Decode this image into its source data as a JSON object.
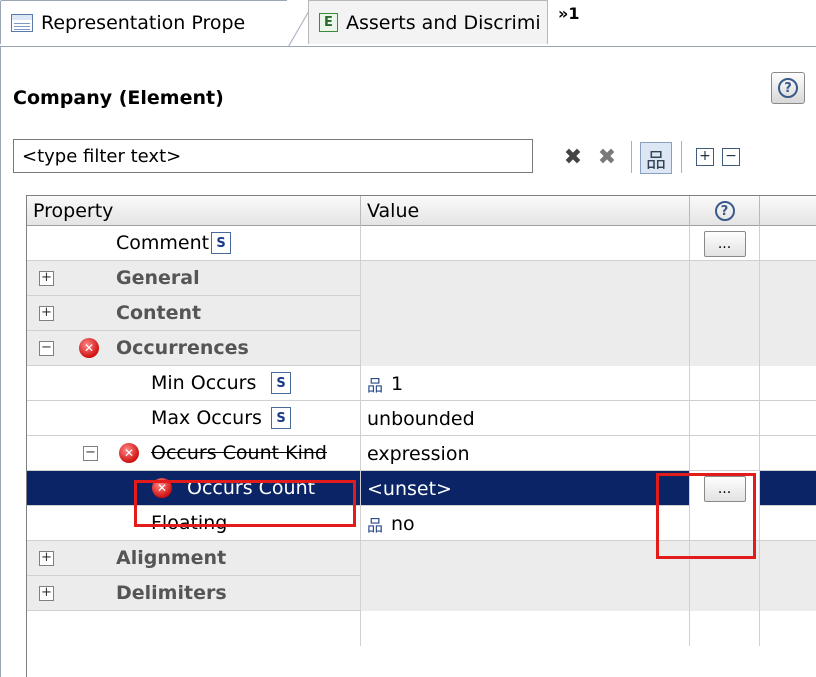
{
  "tabs": [
    {
      "label": "Representation Prope",
      "icon": "doc-icon",
      "active": true
    },
    {
      "label": "Asserts and Discrimi",
      "icon": "assert-icon",
      "active": false
    }
  ],
  "tab_overflow": "»1",
  "panel": {
    "title": "Company (Element)",
    "help_icon": "?"
  },
  "filter": {
    "value": "<type filter text>"
  },
  "toolbar": {
    "clear_icon": "✖",
    "clear_all_icon": "✖",
    "hierarchy_icon": "品",
    "expand_all_icon": "+",
    "collapse_all_icon": "−"
  },
  "table": {
    "headers": [
      "Property",
      "Value",
      "?"
    ],
    "rows": [
      {
        "type": "prop",
        "label": "Comment",
        "s_icon": "S",
        "value": "",
        "has_dots": true
      },
      {
        "type": "cat",
        "label": "General",
        "expanded": false
      },
      {
        "type": "cat",
        "label": "Content",
        "expanded": false
      },
      {
        "type": "cat",
        "label": "Occurrences",
        "expanded": true,
        "error": true
      },
      {
        "type": "prop",
        "label": "Min Occurs",
        "s_icon": "S",
        "value_icon": "品",
        "value": "1"
      },
      {
        "type": "prop",
        "label": "Max Occurs",
        "s_icon": "S",
        "value": "unbounded"
      },
      {
        "type": "subcat",
        "label": "Occurs Count Kind",
        "value": "expression",
        "error": true
      },
      {
        "type": "prop-sel",
        "label": "Occurs Count",
        "value": "<unset>",
        "error": true,
        "has_dots": true
      },
      {
        "type": "prop",
        "label": "Floating",
        "value_icon": "品",
        "value": "no"
      },
      {
        "type": "cat",
        "label": "Alignment",
        "expanded": false
      },
      {
        "type": "cat",
        "label": "Delimiters",
        "expanded": false
      }
    ],
    "dots_label": "...",
    "expand_glyph": "+",
    "collapse_glyph": "−",
    "error_glyph": "✕"
  },
  "colors": {
    "selection": "#0a2466",
    "highlight": "#e31b1b"
  }
}
